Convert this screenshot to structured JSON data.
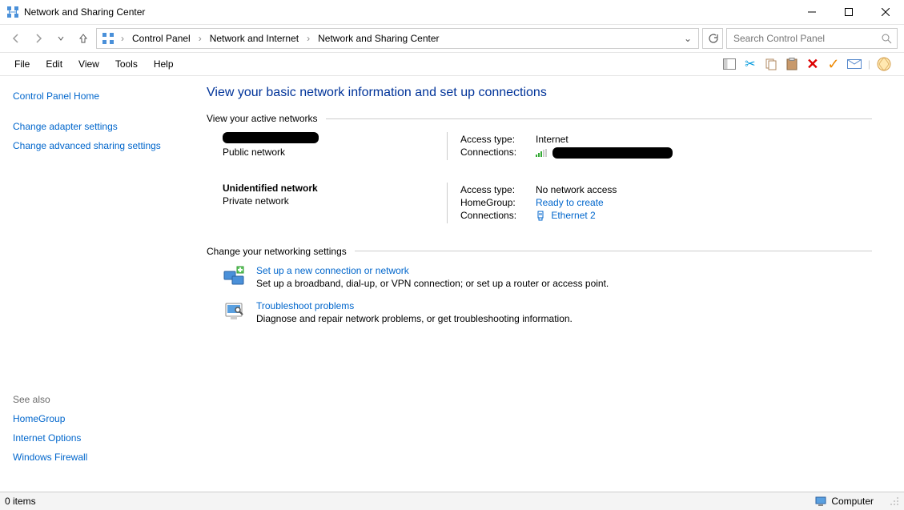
{
  "titlebar": {
    "title": "Network and Sharing Center"
  },
  "breadcrumb": {
    "items": [
      "Control Panel",
      "Network and Internet",
      "Network and Sharing Center"
    ]
  },
  "search": {
    "placeholder": "Search Control Panel"
  },
  "menu": {
    "file": "File",
    "edit": "Edit",
    "view": "View",
    "tools": "Tools",
    "help": "Help"
  },
  "sidebar": {
    "home": "Control Panel Home",
    "adapter": "Change adapter settings",
    "advanced": "Change advanced sharing settings",
    "see_also": "See also",
    "homegroup": "HomeGroup",
    "inetopt": "Internet Options",
    "firewall": "Windows Firewall"
  },
  "main": {
    "heading": "View your basic network information and set up connections",
    "active_networks": "View your active networks",
    "change_settings": "Change your networking settings",
    "net1": {
      "type": "Public network",
      "access_label": "Access type:",
      "access_value": "Internet",
      "conn_label": "Connections:"
    },
    "net2": {
      "name": "Unidentified network",
      "type": "Private network",
      "access_label": "Access type:",
      "access_value": "No network access",
      "hg_label": "HomeGroup:",
      "hg_value": "Ready to create",
      "conn_label": "Connections:",
      "conn_value": "Ethernet 2"
    },
    "task1": {
      "title": "Set up a new connection or network",
      "desc": "Set up a broadband, dial-up, or VPN connection; or set up a router or access point."
    },
    "task2": {
      "title": "Troubleshoot problems",
      "desc": "Diagnose and repair network problems, or get troubleshooting information."
    }
  },
  "statusbar": {
    "items": "0 items",
    "computer": "Computer"
  }
}
